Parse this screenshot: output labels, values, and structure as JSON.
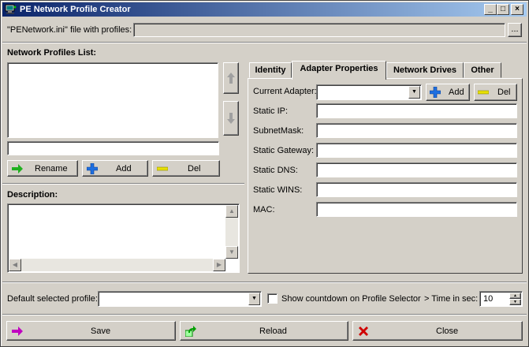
{
  "window": {
    "title": "PE Network Profile Creator",
    "controls": {
      "minimize": "_",
      "maximize": "□",
      "close": "×"
    }
  },
  "file": {
    "label": "\"PENetwork.ini\" file with profiles:",
    "value": "",
    "browse_label": "..."
  },
  "profiles": {
    "heading": "Network Profiles List:",
    "items": [],
    "name_value": "",
    "rename_label": "Rename",
    "add_label": "Add",
    "del_label": "Del"
  },
  "description": {
    "heading": "Description:",
    "value": ""
  },
  "tabs": [
    {
      "label": "Identity"
    },
    {
      "label": "Adapter Properties"
    },
    {
      "label": "Network Drives"
    },
    {
      "label": "Other"
    }
  ],
  "adapter": {
    "current_label": "Current Adapter:",
    "current_value": "",
    "add_label": "Add",
    "del_label": "Del",
    "fields": [
      {
        "label": "Static IP:",
        "value": ""
      },
      {
        "label": "SubnetMask:",
        "value": ""
      },
      {
        "label": "Static Gateway:",
        "value": ""
      },
      {
        "label": "Static DNS:",
        "value": ""
      },
      {
        "label": "Static WINS:",
        "value": ""
      },
      {
        "label": "MAC:",
        "value": ""
      }
    ]
  },
  "footer": {
    "default_profile_label": "Default selected profile:",
    "default_profile_value": "",
    "countdown_label": "Show countdown on Profile Selector",
    "countdown_checked": false,
    "time_label": "> Time in sec:",
    "time_value": "10"
  },
  "actions": {
    "save_label": "Save",
    "reload_label": "Reload",
    "close_label": "Close"
  },
  "colors": {
    "title_start": "#0a246a",
    "title_end": "#a6caf0",
    "face": "#d4d0c8",
    "add_icon": "#1e6fe0",
    "del_icon": "#e8e000",
    "close_icon": "#d00000",
    "save_icon": "#c000c0",
    "rename_icon": "#20b020"
  }
}
